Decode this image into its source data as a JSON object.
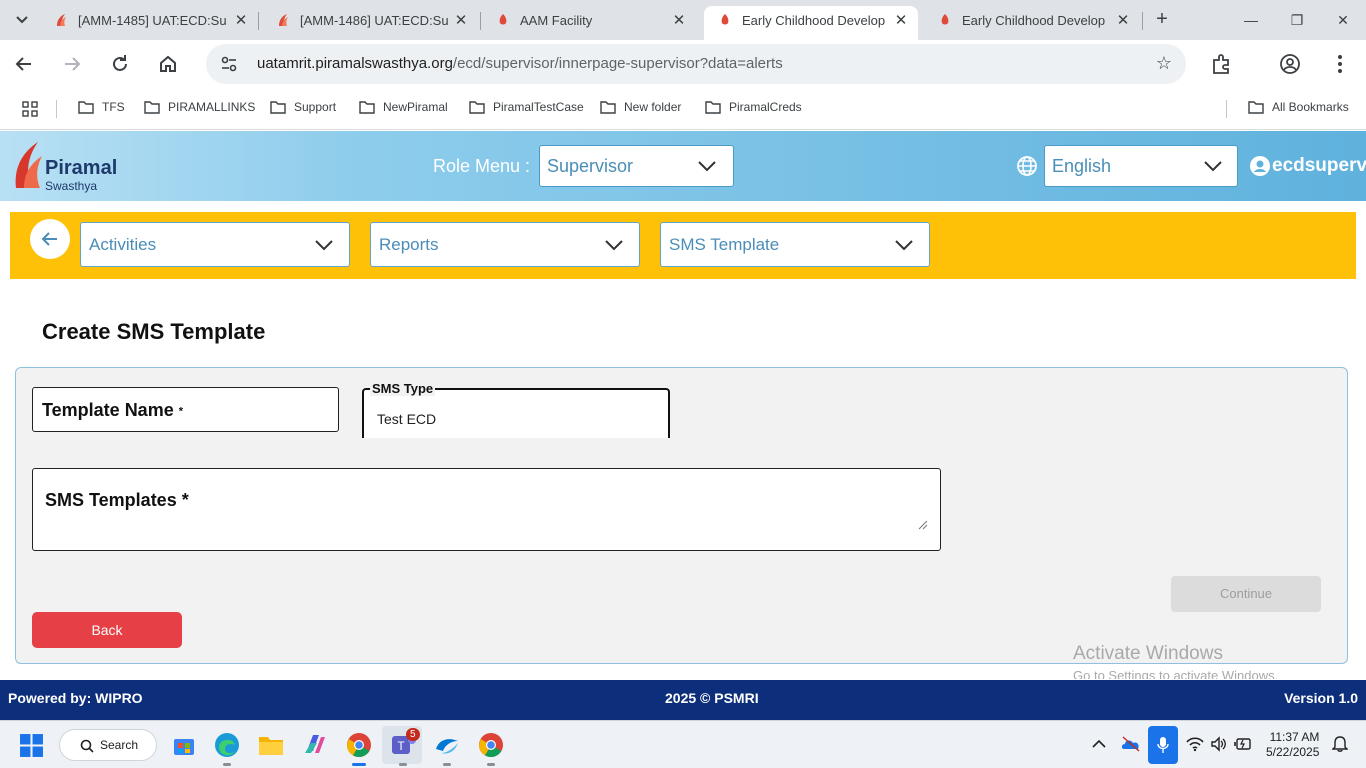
{
  "browser": {
    "tabs": [
      {
        "title": "[AMM-1485] UAT:ECD:Su",
        "active": false
      },
      {
        "title": "[AMM-1486] UAT:ECD:Su",
        "active": false
      },
      {
        "title": "AAM Facility",
        "active": false
      },
      {
        "title": "Early Childhood Develop",
        "active": true
      },
      {
        "title": "Early Childhood Develop",
        "active": false
      }
    ],
    "url_host": "uatamrit.piramalswasthya.org",
    "url_path": "/ecd/supervisor/innerpage-supervisor?data=alerts",
    "bookmarks": [
      "TFS",
      "PIRAMALLINKS",
      "Support",
      "NewPiramal",
      "PiramalTestCase",
      "New folder",
      "PiramalCreds"
    ],
    "all_bookmarks": "All Bookmarks"
  },
  "header": {
    "logo_text": "Piramal",
    "logo_sub": "Swasthya",
    "role_label": "Role Menu :",
    "role_value": "Supervisor",
    "language_value": "English",
    "username": "ecdsupervis"
  },
  "subnav": {
    "activities": "Activities",
    "reports": "Reports",
    "sms_template": "SMS Template"
  },
  "form": {
    "page_title": "Create SMS Template",
    "template_name_label": "Template Name",
    "required_mark": "*",
    "sms_type_legend": "SMS Type",
    "sms_type_value": "Test ECD",
    "sms_templates_label": "SMS Templates *",
    "continue_label": "Continue",
    "back_label": "Back"
  },
  "watermark": {
    "line1": "Activate Windows",
    "line2": "Go to Settings to activate Windows."
  },
  "footer": {
    "powered_by": "Powered by: WIPRO",
    "copyright": "2025 © PSMRI",
    "version": "Version 1.0"
  },
  "taskbar": {
    "search_label": "Search",
    "teams_badge": "5",
    "time": "11:37 AM",
    "date": "5/22/2025"
  },
  "colors": {
    "accent_yellow": "#fec107",
    "header_blue": "#5fb2dd",
    "footer_navy": "#0d2e7a",
    "back_red": "#e64046"
  }
}
